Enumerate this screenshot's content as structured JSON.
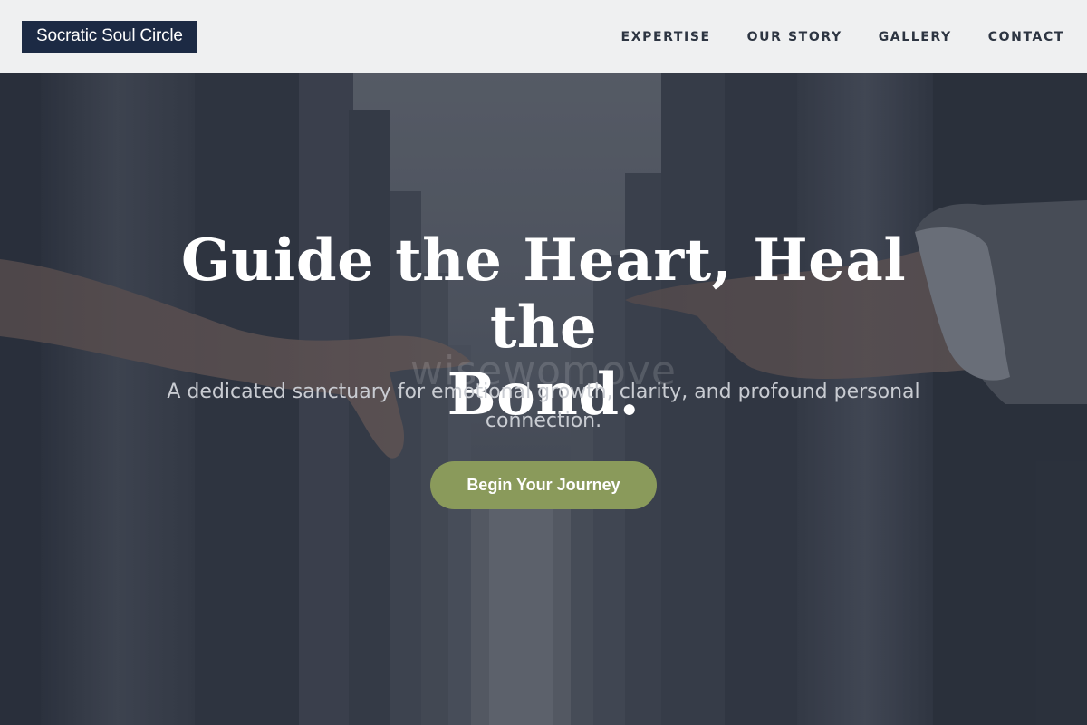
{
  "brand": {
    "name": "Socratic Soul Circle"
  },
  "nav": {
    "items": [
      {
        "label": "EXPERTISE"
      },
      {
        "label": "OUR STORY"
      },
      {
        "label": "GALLERY"
      },
      {
        "label": "CONTACT"
      }
    ]
  },
  "hero": {
    "title_line1": "Guide the Heart, Heal the",
    "title_line2": "Bond.",
    "watermark": "wisewomove",
    "subtitle": "A dedicated sanctuary for emotional growth, clarity, and profound personal connection.",
    "cta_label": "Begin Your Journey",
    "background": "hands-reaching-between-concrete-pillars"
  },
  "colors": {
    "header_bg": "#eff0f1",
    "logo_bg": "#1c2a44",
    "nav_text": "#2d3542",
    "cta_bg": "#8a9a5b",
    "hero_text": "#ffffff"
  }
}
